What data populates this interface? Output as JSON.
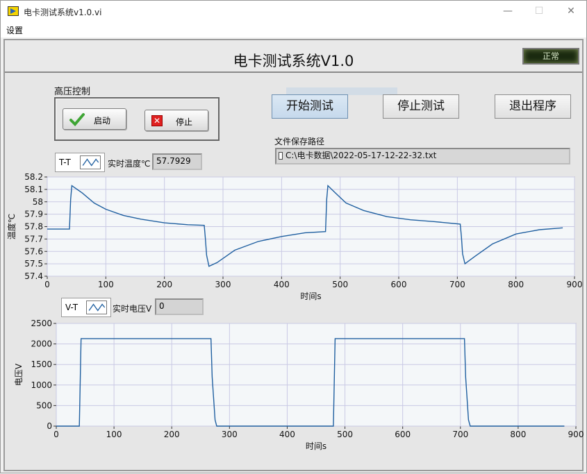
{
  "window": {
    "title": "电卡测试系统v1.0.vi",
    "controls": {
      "minimize": "—",
      "maximize": "☐",
      "close": "✕"
    }
  },
  "menu": {
    "items": [
      "设置"
    ]
  },
  "header": {
    "title": "电卡测试系统V1.0",
    "status": "正常"
  },
  "hv_control": {
    "label": "高压控制",
    "start_label": "启动",
    "stop_label": "停止"
  },
  "buttons": {
    "start_test": "开始测试",
    "stop_test": "停止测试",
    "exit": "退出程序"
  },
  "file_path": {
    "label": "文件保存路径",
    "value": "C:\\电卡数据\\2022-05-17-12-22-32.txt"
  },
  "temp_panel": {
    "legend": "T-T",
    "indicator_label": "实时温度℃",
    "indicator_value": "57.7929"
  },
  "volt_panel": {
    "legend": "V-T",
    "indicator_label": "实时电压V",
    "indicator_value": "0"
  },
  "colors": {
    "plot_line": "#1f5fa0",
    "plot_bg": "#f4f7f9",
    "grid": "#c9c9e4"
  },
  "chart_data": [
    {
      "type": "line",
      "ylabel": "温度℃",
      "xlabel": "时间s",
      "xlim": [
        0,
        900
      ],
      "ylim": [
        57.4,
        58.2
      ],
      "xticks": [
        0,
        100,
        200,
        300,
        400,
        500,
        600,
        700,
        800,
        900
      ],
      "yticks": [
        58.2,
        58.1,
        58.0,
        57.9,
        57.8,
        57.7,
        57.6,
        57.5,
        57.4
      ],
      "ytick_labels": [
        "58.2",
        "58.1",
        "58",
        "57.9",
        "57.8",
        "57.7",
        "57.6",
        "57.5",
        "57.4"
      ],
      "grid": true,
      "x": [
        0,
        38,
        40,
        42,
        60,
        80,
        100,
        130,
        160,
        200,
        240,
        268,
        270,
        272,
        276,
        290,
        320,
        360,
        400,
        440,
        475,
        477,
        479,
        490,
        510,
        540,
        580,
        620,
        660,
        705,
        707,
        709,
        713,
        730,
        760,
        800,
        840,
        880
      ],
      "y": [
        57.78,
        57.78,
        58.02,
        58.13,
        58.07,
        57.99,
        57.94,
        57.89,
        57.86,
        57.83,
        57.815,
        57.81,
        57.7,
        57.57,
        57.48,
        57.51,
        57.61,
        57.68,
        57.72,
        57.75,
        57.76,
        58.02,
        58.13,
        58.08,
        57.99,
        57.93,
        57.88,
        57.855,
        57.84,
        57.82,
        57.72,
        57.58,
        57.5,
        57.56,
        57.66,
        57.74,
        57.775,
        57.79
      ]
    },
    {
      "type": "line",
      "ylabel": "电压V",
      "xlabel": "时间s",
      "xlim": [
        0,
        900
      ],
      "ylim": [
        0,
        2500
      ],
      "xticks": [
        0,
        100,
        200,
        300,
        400,
        500,
        600,
        700,
        800,
        900
      ],
      "yticks": [
        2500,
        2000,
        1500,
        1000,
        500,
        0
      ],
      "ytick_labels": [
        "2500",
        "2000",
        "1500",
        "1000",
        "500",
        "0"
      ],
      "grid": true,
      "x": [
        0,
        40,
        43,
        268,
        270,
        275,
        278,
        480,
        483,
        707,
        709,
        714,
        717,
        880
      ],
      "y": [
        0,
        0,
        2130,
        2130,
        1200,
        150,
        0,
        0,
        2130,
        2130,
        1200,
        150,
        0,
        0
      ]
    }
  ]
}
